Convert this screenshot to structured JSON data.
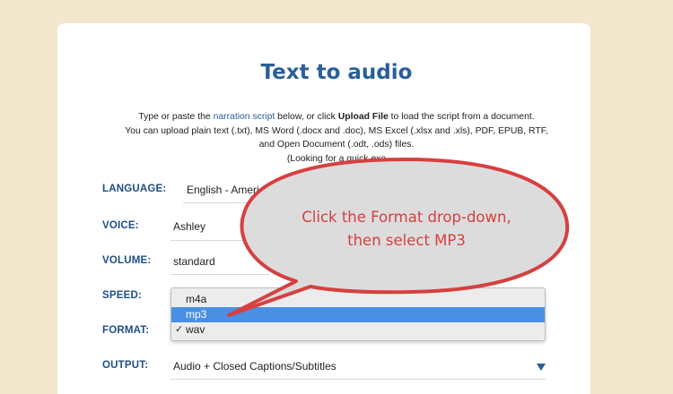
{
  "page": {
    "title": "Text to audio",
    "intro": {
      "line1_a": "Type or paste the ",
      "line1_link": "narration script",
      "line1_b": " below, or click ",
      "line1_bold": "Upload File",
      "line1_c": " to load the script from a document.",
      "line2": "You can upload plain text (.txt), MS Word (.docx and .doc), MS Excel (.xlsx and .xls), PDF, EPUB, RTF,",
      "line3": "and Open Document (.odt, .ods) files.",
      "line4": "(Looking for a quick exa"
    }
  },
  "form": {
    "language_label": "LANGUAGE:",
    "language_value": "English - Americ",
    "voice_label": "VOICE:",
    "voice_value": "Ashley",
    "volume_label": "VOLUME:",
    "volume_value": "standard",
    "speed_label": "SPEED:",
    "format_label": "FORMAT:",
    "output_label": "OUTPUT:",
    "output_value": "Audio + Closed Captions/Subtitles"
  },
  "format_dropdown": {
    "options": [
      "m4a",
      "mp3",
      "wav"
    ],
    "highlighted": "mp3",
    "checked": "wav",
    "check_glyph": "✓"
  },
  "callout": {
    "line1": "Click the Format drop-down,",
    "line2": "then select MP3",
    "text_color": "#d64040",
    "fill_color": "#dcdcdc",
    "stroke_color": "#d64040"
  },
  "colors": {
    "background": "#f3e7cd",
    "accent": "#2a5f98",
    "selection": "#4a90e2"
  }
}
